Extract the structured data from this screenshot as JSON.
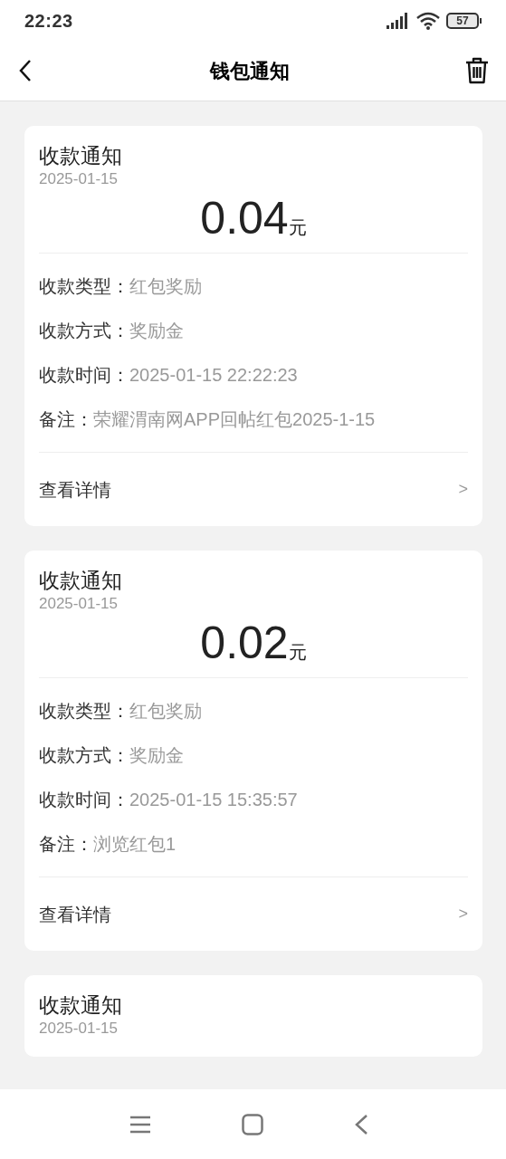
{
  "status_bar": {
    "time": "22:23",
    "battery": "57"
  },
  "header": {
    "title": "钱包通知"
  },
  "notifications": [
    {
      "title": "收款通知",
      "date": "2025-01-15",
      "amount": "0.04",
      "unit": "元",
      "details": [
        {
          "label": "收款类型：",
          "value": "红包奖励"
        },
        {
          "label": "收款方式：",
          "value": "奖励金"
        },
        {
          "label": "收款时间：",
          "value": "2025-01-15 22:22:23"
        },
        {
          "label": "备注：",
          "value": "荣耀渭南网APP回帖红包2025-1-15"
        }
      ],
      "link": "查看详情",
      "chevron": ">"
    },
    {
      "title": "收款通知",
      "date": "2025-01-15",
      "amount": "0.02",
      "unit": "元",
      "details": [
        {
          "label": "收款类型：",
          "value": "红包奖励"
        },
        {
          "label": "收款方式：",
          "value": "奖励金"
        },
        {
          "label": "收款时间：",
          "value": "2025-01-15 15:35:57"
        },
        {
          "label": "备注：",
          "value": "浏览红包1"
        }
      ],
      "link": "查看详情",
      "chevron": ">"
    },
    {
      "title": "收款通知",
      "date": "2025-01-15"
    }
  ]
}
